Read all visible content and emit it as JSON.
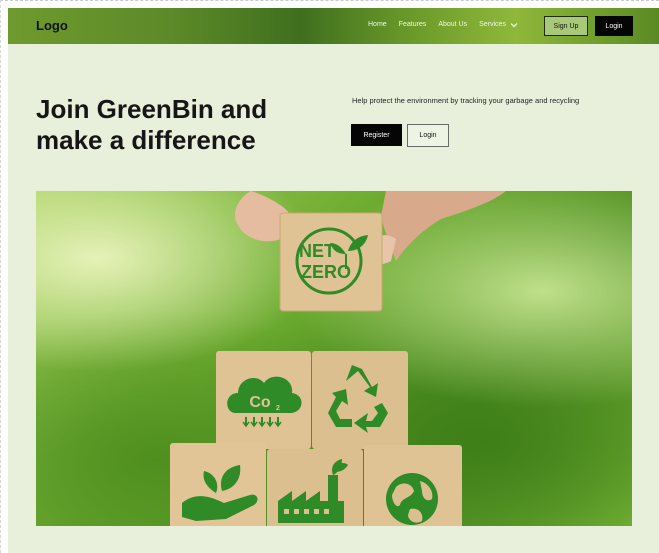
{
  "nav": {
    "logo": "Logo",
    "links": [
      "Home",
      "Features",
      "About Us",
      "Services"
    ],
    "signup_label": "Sign Up",
    "login_label": "Login"
  },
  "hero": {
    "title": "Join GreenBin and make a difference",
    "subtitle": "Help protect the environment by tracking your garbage and recycling",
    "register_label": "Register",
    "login_label": "Login"
  },
  "image": {
    "block_text": [
      "NET",
      "ZERO"
    ],
    "co2_text": "Co",
    "co2_subscript": "2",
    "icons": [
      "net-zero-icon",
      "co2-cloud-icon",
      "recycle-icon",
      "hand-leaf-icon",
      "factory-icon",
      "globe-icon"
    ]
  },
  "colors": {
    "page_background": "#e8f0db",
    "nav_green": "#4f7f22",
    "icon_green": "#2f8a28",
    "block_wood": "#e2c79a",
    "button_dark": "#050505"
  }
}
